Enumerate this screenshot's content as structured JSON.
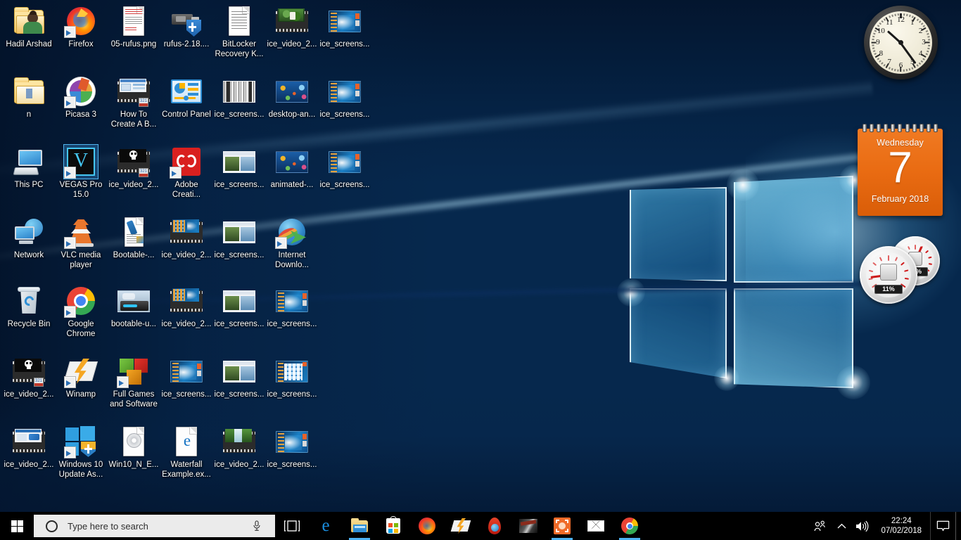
{
  "desktop": {
    "wallpaper_name": "windows-10-hero-blue",
    "icons": [
      {
        "label": "Hadil Arshad",
        "art": "folder-user",
        "shortcut": false,
        "col": 0,
        "row": 0
      },
      {
        "label": "Firefox",
        "art": "firefox",
        "shortcut": true,
        "col": 1,
        "row": 0
      },
      {
        "label": "05-rufus.png",
        "art": "image-doc",
        "shortcut": false,
        "col": 2,
        "row": 0
      },
      {
        "label": "rufus-2.18....",
        "art": "usb-shield",
        "shortcut": false,
        "col": 3,
        "row": 0
      },
      {
        "label": "BitLocker Recovery K...",
        "art": "text-doc",
        "shortcut": false,
        "col": 4,
        "row": 0
      },
      {
        "label": "ice_video_2...",
        "art": "film-forest",
        "shortcut": false,
        "col": 5,
        "row": 0
      },
      {
        "label": "ice_screens...",
        "art": "shot-win10",
        "shortcut": false,
        "col": 6,
        "row": 0
      },
      {
        "label": "n",
        "art": "folder-open",
        "shortcut": false,
        "col": 0,
        "row": 1
      },
      {
        "label": "Picasa 3",
        "art": "picasa",
        "shortcut": true,
        "col": 1,
        "row": 1
      },
      {
        "label": "How To Create A B...",
        "art": "film-howto",
        "shortcut": false,
        "col": 2,
        "row": 1
      },
      {
        "label": "Control Panel",
        "art": "control-panel",
        "shortcut": false,
        "col": 3,
        "row": 1
      },
      {
        "label": "ice_screens...",
        "art": "shot-grey",
        "shortcut": false,
        "col": 4,
        "row": 1
      },
      {
        "label": "desktop-an...",
        "art": "shot-aquarium",
        "shortcut": false,
        "col": 5,
        "row": 1
      },
      {
        "label": "ice_screens...",
        "art": "shot-win10",
        "shortcut": false,
        "col": 6,
        "row": 1
      },
      {
        "label": "This PC",
        "art": "this-pc",
        "shortcut": false,
        "col": 0,
        "row": 2
      },
      {
        "label": "VEGAS Pro 15.0",
        "art": "vegas-pro",
        "shortcut": true,
        "selected": true,
        "col": 1,
        "row": 2
      },
      {
        "label": "ice_video_2...",
        "art": "film-skull",
        "shortcut": false,
        "col": 2,
        "row": 2
      },
      {
        "label": "Adobe Creati...",
        "art": "adobe-cc",
        "shortcut": true,
        "col": 3,
        "row": 2
      },
      {
        "label": "ice_screens...",
        "art": "shot-window",
        "shortcut": false,
        "col": 4,
        "row": 2
      },
      {
        "label": "animated-...",
        "art": "shot-aquarium",
        "shortcut": false,
        "col": 5,
        "row": 2
      },
      {
        "label": "ice_screens...",
        "art": "shot-win10",
        "shortcut": false,
        "col": 6,
        "row": 2
      },
      {
        "label": "Network",
        "art": "network",
        "shortcut": false,
        "col": 0,
        "row": 3
      },
      {
        "label": "VLC media player",
        "art": "vlc",
        "shortcut": true,
        "col": 1,
        "row": 3
      },
      {
        "label": "Bootable-...",
        "art": "usb-doc",
        "shortcut": false,
        "col": 2,
        "row": 3
      },
      {
        "label": "ice_video_2...",
        "art": "film-tiles",
        "shortcut": false,
        "col": 3,
        "row": 3
      },
      {
        "label": "ice_screens...",
        "art": "shot-window",
        "shortcut": false,
        "col": 4,
        "row": 3
      },
      {
        "label": "Internet Downlo...",
        "art": "idm",
        "shortcut": true,
        "col": 5,
        "row": 3
      },
      {
        "label": "Recycle Bin",
        "art": "recycle-bin",
        "shortcut": false,
        "col": 0,
        "row": 4
      },
      {
        "label": "Google Chrome",
        "art": "chrome",
        "shortcut": true,
        "col": 1,
        "row": 4
      },
      {
        "label": "bootable-u...",
        "art": "shot-drive",
        "shortcut": false,
        "col": 2,
        "row": 4
      },
      {
        "label": "ice_video_2...",
        "art": "film-tiles",
        "shortcut": false,
        "col": 3,
        "row": 4
      },
      {
        "label": "ice_screens...",
        "art": "shot-window",
        "shortcut": false,
        "col": 4,
        "row": 4
      },
      {
        "label": "ice_screens...",
        "art": "shot-win10",
        "shortcut": false,
        "col": 5,
        "row": 4
      },
      {
        "label": "ice_video_2...",
        "art": "film-skull",
        "shortcut": false,
        "col": 0,
        "row": 5
      },
      {
        "label": "Winamp",
        "art": "winamp",
        "shortcut": true,
        "col": 1,
        "row": 5
      },
      {
        "label": "Full Games and Software",
        "art": "cubes",
        "shortcut": true,
        "col": 2,
        "row": 5
      },
      {
        "label": "ice_screens...",
        "art": "shot-win10",
        "shortcut": false,
        "col": 3,
        "row": 5
      },
      {
        "label": "ice_screens...",
        "art": "shot-window",
        "shortcut": false,
        "col": 4,
        "row": 5
      },
      {
        "label": "ice_screens...",
        "art": "shot-tiles",
        "shortcut": false,
        "col": 5,
        "row": 5
      },
      {
        "label": "ice_video_2...",
        "art": "film-usb",
        "shortcut": false,
        "col": 0,
        "row": 6
      },
      {
        "label": "Windows 10 Update As...",
        "art": "win-shield",
        "shortcut": true,
        "col": 1,
        "row": 6
      },
      {
        "label": "Win10_N_E...",
        "art": "disc-doc",
        "shortcut": false,
        "col": 2,
        "row": 6
      },
      {
        "label": "Waterfall Example.ex...",
        "art": "edge-doc",
        "shortcut": false,
        "col": 3,
        "row": 6
      },
      {
        "label": "ice_video_2...",
        "art": "film-waterfall",
        "shortcut": false,
        "col": 4,
        "row": 6
      },
      {
        "label": "ice_screens...",
        "art": "shot-win10",
        "shortcut": false,
        "col": 5,
        "row": 6
      }
    ]
  },
  "gadgets": {
    "clock": {
      "name": "analog-clock-gadget",
      "hour_numbers": [
        "12",
        "1",
        "2",
        "3",
        "4",
        "5",
        "6",
        "7",
        "8",
        "9",
        "10",
        "11"
      ],
      "time_shown": "10:24",
      "hour_angle_deg": 312,
      "minute_angle_deg": 144
    },
    "calendar": {
      "name": "calendar-gadget",
      "weekday": "Wednesday",
      "date": "7",
      "month_year": "February 2018",
      "accent": "#e96b12"
    },
    "meter": {
      "name": "cpu-ram-meter-gadget",
      "cpu_label": "11%",
      "ram_label": "59%",
      "cpu_value": 11,
      "ram_value": 59,
      "needle_color": "#cc1a1a"
    }
  },
  "taskbar": {
    "start": {
      "name": "start-button",
      "tooltip": "Start"
    },
    "search": {
      "placeholder": "Type here to search",
      "value": "",
      "cortana_icon": "cortana-circle-icon",
      "mic_icon": "microphone-icon"
    },
    "task_view": {
      "label": "Task View",
      "icon": "task-view-icon"
    },
    "apps": [
      {
        "name": "microsoft-edge",
        "label": "Microsoft Edge",
        "art": "edge",
        "running": false
      },
      {
        "name": "file-explorer",
        "label": "File Explorer",
        "art": "explorer",
        "running": true
      },
      {
        "name": "microsoft-store",
        "label": "Microsoft Store",
        "art": "store",
        "running": false
      },
      {
        "name": "mozilla-firefox",
        "label": "Mozilla Firefox",
        "art": "firefox",
        "running": false
      },
      {
        "name": "winamp",
        "label": "Winamp",
        "art": "winamp",
        "running": false
      },
      {
        "name": "internet-download-manager",
        "label": "Internet Download Manager",
        "art": "idm-drop",
        "running": false
      },
      {
        "name": "dark-thumbnail-app",
        "label": "Media App",
        "art": "dark-thumb",
        "running": false
      },
      {
        "name": "orange-app",
        "label": "Orange App",
        "art": "orange-square",
        "running": true
      },
      {
        "name": "mail",
        "label": "Mail",
        "art": "mail",
        "running": false
      },
      {
        "name": "google-chrome",
        "label": "Google Chrome",
        "art": "chrome",
        "running": true
      }
    ],
    "tray": {
      "people_icon": "people-icon",
      "chevron_icon": "chevron-up-icon",
      "volume_icon": "speaker-icon",
      "time": "22:24",
      "date": "07/02/2018",
      "action_center_icon": "action-center-icon",
      "show_desktop": "show-desktop-button"
    }
  },
  "colors": {
    "taskbar_bg": "#000000",
    "search_bg": "#ebebeb",
    "accent_blue": "#0078d7",
    "running_underline": "#4cb2f2",
    "wallpaper_blue": "#1e87d6",
    "calendar_orange": "#e96b12"
  }
}
